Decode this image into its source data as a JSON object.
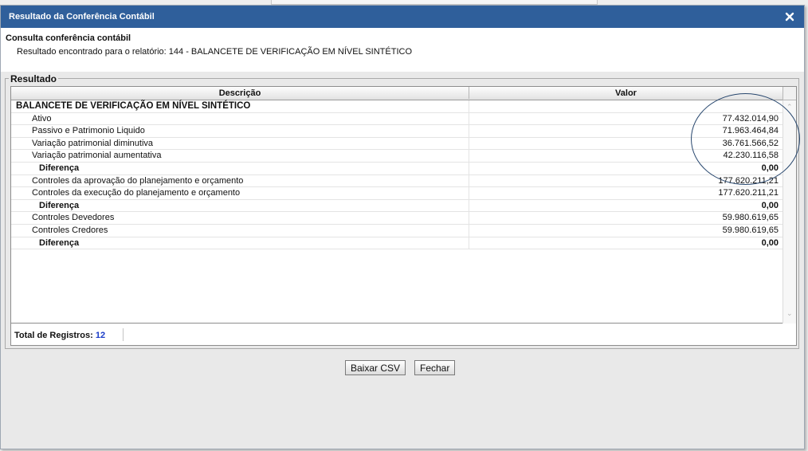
{
  "dialog": {
    "title": "Resultado da Conferência Contábil",
    "subtitle": "Consulta conferência contábil",
    "info": "Resultado encontrado para o relatório: 144 - BALANCETE DE VERIFICAÇÃO EM NÍVEL SINTÉTICO"
  },
  "result_group": {
    "legend": "Resultado",
    "columns": [
      "Descrição",
      "Valor"
    ],
    "rows": [
      {
        "desc": "BALANCETE DE VERIFICAÇÃO EM NÍVEL SINTÉTICO",
        "val": ""
      },
      {
        "desc": "Ativo",
        "val": "77.432.014,90"
      },
      {
        "desc": "Passivo e Patrimonio Liquido",
        "val": "71.963.464,84"
      },
      {
        "desc": "Variação patrimonial diminutiva",
        "val": "36.761.566,52"
      },
      {
        "desc": "Variação patrimonial aumentativa",
        "val": "42.230.116,58"
      },
      {
        "desc": "Diferença",
        "val": "0,00"
      },
      {
        "desc": "Controles da aprovação do planejamento e orçamento",
        "val": "177.620.211,21"
      },
      {
        "desc": "Controles da execução do planejamento e orçamento",
        "val": "177.620.211,21"
      },
      {
        "desc": "Diferença",
        "val": "0,00"
      },
      {
        "desc": "Controles Devedores",
        "val": "59.980.619,65"
      },
      {
        "desc": "Controles Credores",
        "val": "59.980.619,65"
      },
      {
        "desc": "Diferença",
        "val": "0,00"
      }
    ],
    "footer_label": "Total de Registros:",
    "footer_count": "12"
  },
  "buttons": {
    "csv": "Baixar CSV",
    "close": "Fechar"
  },
  "icons": {
    "close": "close-x-icon"
  },
  "colors": {
    "titlebar": "#2f5f9b",
    "count": "#1a3cc8",
    "annotation": "#28476e"
  }
}
